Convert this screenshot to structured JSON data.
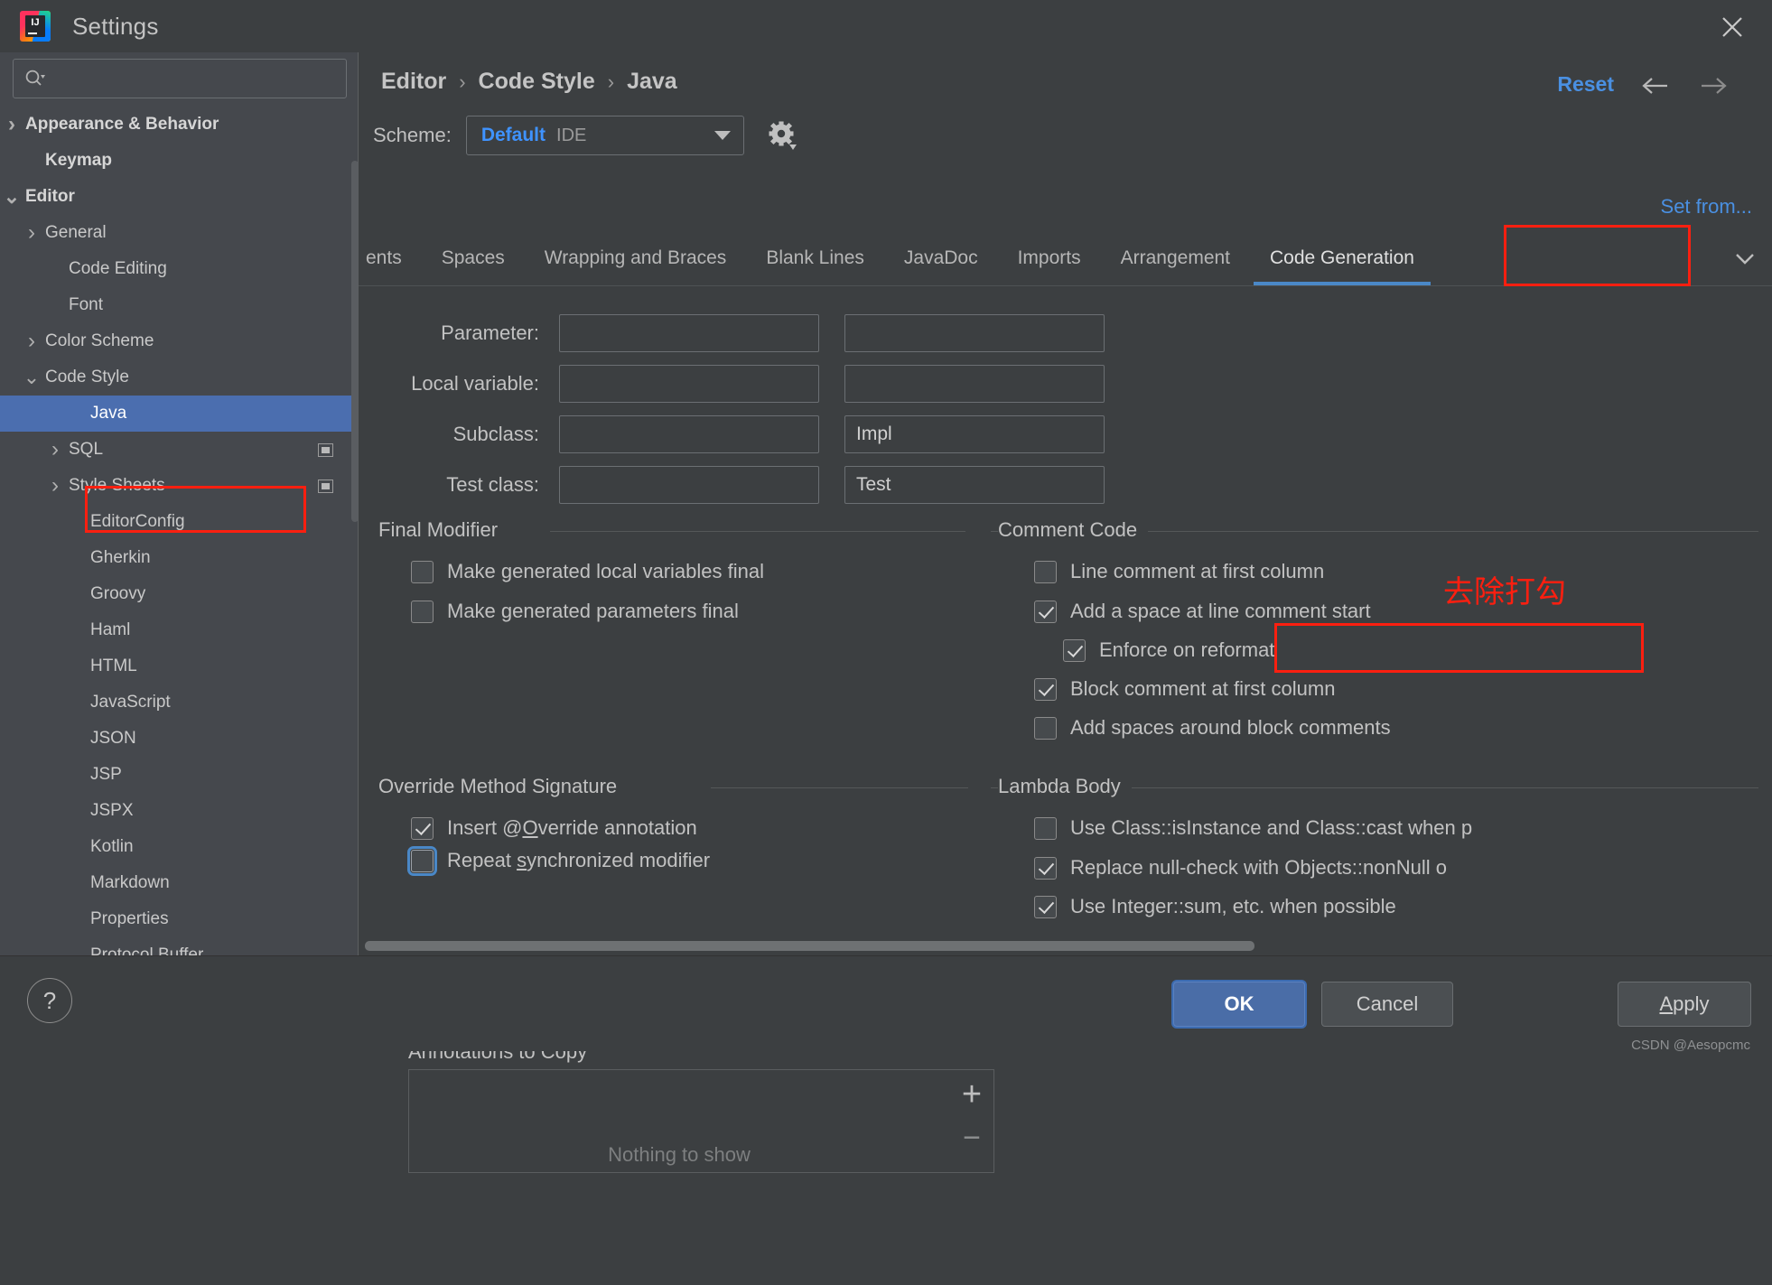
{
  "window": {
    "title": "Settings",
    "logo_text": "IJ",
    "close_icon": "close-icon"
  },
  "sidebar": {
    "search": {
      "placeholder": "",
      "value": "",
      "icon": "search-icon"
    },
    "items": [
      {
        "label": "Appearance & Behavior",
        "arrow": "›",
        "indent": 22,
        "bold": true,
        "selected": false,
        "badge": false
      },
      {
        "label": "Keymap",
        "arrow": "",
        "indent": 48,
        "bold": true,
        "selected": false,
        "badge": false
      },
      {
        "label": "Editor",
        "arrow": "⌄",
        "indent": 22,
        "bold": true,
        "selected": false,
        "badge": false
      },
      {
        "label": "General",
        "arrow": "›",
        "indent": 48,
        "bold": false,
        "selected": false,
        "badge": false
      },
      {
        "label": "Code Editing",
        "arrow": "",
        "indent": 74,
        "bold": false,
        "selected": false,
        "badge": false
      },
      {
        "label": "Font",
        "arrow": "",
        "indent": 74,
        "bold": false,
        "selected": false,
        "badge": false
      },
      {
        "label": "Color Scheme",
        "arrow": "›",
        "indent": 48,
        "bold": false,
        "selected": false,
        "badge": false
      },
      {
        "label": "Code Style",
        "arrow": "⌄",
        "indent": 48,
        "bold": false,
        "selected": false,
        "badge": false
      },
      {
        "label": "Java",
        "arrow": "",
        "indent": 98,
        "bold": false,
        "selected": true,
        "badge": false
      },
      {
        "label": "SQL",
        "arrow": "›",
        "indent": 74,
        "bold": false,
        "selected": false,
        "badge": true
      },
      {
        "label": "Style Sheets",
        "arrow": "›",
        "indent": 74,
        "bold": false,
        "selected": false,
        "badge": true
      },
      {
        "label": "EditorConfig",
        "arrow": "",
        "indent": 98,
        "bold": false,
        "selected": false,
        "badge": false
      },
      {
        "label": "Gherkin",
        "arrow": "",
        "indent": 98,
        "bold": false,
        "selected": false,
        "badge": false
      },
      {
        "label": "Groovy",
        "arrow": "",
        "indent": 98,
        "bold": false,
        "selected": false,
        "badge": false
      },
      {
        "label": "Haml",
        "arrow": "",
        "indent": 98,
        "bold": false,
        "selected": false,
        "badge": false
      },
      {
        "label": "HTML",
        "arrow": "",
        "indent": 98,
        "bold": false,
        "selected": false,
        "badge": false
      },
      {
        "label": "JavaScript",
        "arrow": "",
        "indent": 98,
        "bold": false,
        "selected": false,
        "badge": false
      },
      {
        "label": "JSON",
        "arrow": "",
        "indent": 98,
        "bold": false,
        "selected": false,
        "badge": false
      },
      {
        "label": "JSP",
        "arrow": "",
        "indent": 98,
        "bold": false,
        "selected": false,
        "badge": false
      },
      {
        "label": "JSPX",
        "arrow": "",
        "indent": 98,
        "bold": false,
        "selected": false,
        "badge": false
      },
      {
        "label": "Kotlin",
        "arrow": "",
        "indent": 98,
        "bold": false,
        "selected": false,
        "badge": false
      },
      {
        "label": "Markdown",
        "arrow": "",
        "indent": 98,
        "bold": false,
        "selected": false,
        "badge": false
      },
      {
        "label": "Properties",
        "arrow": "",
        "indent": 98,
        "bold": false,
        "selected": false,
        "badge": false
      },
      {
        "label": "Protocol Buffer",
        "arrow": "",
        "indent": 98,
        "bold": false,
        "selected": false,
        "badge": false
      }
    ]
  },
  "header": {
    "breadcrumb": [
      "Editor",
      "Code Style",
      "Java"
    ],
    "breadcrumb_separator": "›",
    "reset_label": "Reset",
    "back_icon": "arrow-left-icon",
    "forward_icon": "arrow-right-icon",
    "scheme_label": "Scheme:",
    "scheme_value": "Default",
    "scheme_scope": "IDE",
    "scheme_gear_icon": "gear-icon",
    "set_from_label": "Set from..."
  },
  "tabs": {
    "items": [
      {
        "label": "ents",
        "active": false,
        "partial": true
      },
      {
        "label": "Spaces",
        "active": false,
        "partial": false
      },
      {
        "label": "Wrapping and Braces",
        "active": false,
        "partial": false
      },
      {
        "label": "Blank Lines",
        "active": false,
        "partial": false
      },
      {
        "label": "JavaDoc",
        "active": false,
        "partial": false
      },
      {
        "label": "Imports",
        "active": false,
        "partial": false
      },
      {
        "label": "Arrangement",
        "active": false,
        "partial": false
      },
      {
        "label": "Code Generation",
        "active": true,
        "partial": false
      }
    ],
    "more_icon": "chevron-down-icon"
  },
  "naming": {
    "rows": [
      {
        "label": "Parameter:",
        "prefix": "",
        "suffix": ""
      },
      {
        "label": "Local variable:",
        "prefix": "",
        "suffix": ""
      },
      {
        "label": "Subclass:",
        "prefix": "",
        "suffix": "Impl"
      },
      {
        "label": "Test class:",
        "prefix": "",
        "suffix": "Test"
      }
    ]
  },
  "final_modifier": {
    "title": "Final Modifier",
    "items": [
      {
        "label": "Make generated local variables final",
        "checked": false,
        "focused": false
      },
      {
        "label": "Make generated parameters final",
        "checked": false,
        "focused": false
      }
    ]
  },
  "comment_code": {
    "title": "Comment Code",
    "items": [
      {
        "label": "Line comment at first column",
        "checked": false,
        "focused": false
      },
      {
        "label": "Add a space at line comment start",
        "checked": true,
        "focused": false
      },
      {
        "label": "Enforce on reformat",
        "checked": true,
        "focused": false
      },
      {
        "label": "Block comment at first column",
        "checked": true,
        "focused": false
      },
      {
        "label": "Add spaces around block comments",
        "checked": false,
        "focused": false
      }
    ]
  },
  "override_method_signature": {
    "title": "Override Method Signature",
    "items": [
      {
        "label": "Insert @Override annotation",
        "checked": true,
        "focused": false
      },
      {
        "label": "Repeat synchronized modifier",
        "checked": false,
        "focused": true
      }
    ],
    "annotations_label": "Annotations to Copy",
    "annotations_empty": "Nothing to show",
    "add_icon": "plus-icon",
    "remove_icon": "minus-icon"
  },
  "lambda_body": {
    "title": "Lambda Body",
    "items": [
      {
        "label": "Use Class::isInstance and Class::cast when p",
        "checked": false,
        "focused": false
      },
      {
        "label": "Replace null-check with Objects::nonNull o",
        "checked": true,
        "focused": false
      },
      {
        "label": "Use Integer::sum, etc. when possible",
        "checked": true,
        "focused": false
      }
    ]
  },
  "footer": {
    "help_label": "?",
    "ok_label": "OK",
    "cancel_label": "Cancel",
    "apply_label": "Apply",
    "watermark": "CSDN @Aesopcmc"
  },
  "annotations": {
    "note_text": "去除打勾"
  },
  "colors": {
    "accent_blue": "#4a90e2",
    "selection_blue": "#4b6eaf",
    "annotation_red": "#fc1f10",
    "panel_bg": "#3c3f41",
    "sidebar_bg": "#45484d"
  }
}
